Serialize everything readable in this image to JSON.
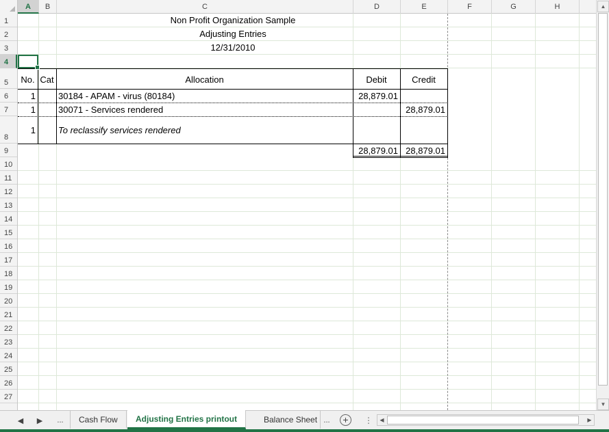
{
  "columns": [
    "A",
    "B",
    "C",
    "D",
    "E",
    "F",
    "G",
    "H"
  ],
  "selected_column": "A",
  "rows": [
    "1",
    "2",
    "3",
    "4",
    "5",
    "6",
    "7",
    "8",
    "9",
    "10",
    "11",
    "12",
    "13",
    "14",
    "15",
    "16",
    "17",
    "18",
    "19",
    "20",
    "21",
    "22",
    "23",
    "24",
    "25",
    "26",
    "27"
  ],
  "selected_row": "4",
  "report": {
    "org_name": "Non Profit Organization Sample",
    "report_title": "Adjusting Entries",
    "report_date": "12/31/2010"
  },
  "table": {
    "headers": {
      "no": "No.",
      "cat": "Cat",
      "allocation": "Allocation",
      "debit": "Debit",
      "credit": "Credit"
    },
    "entries": [
      {
        "no": "1",
        "allocation": "30184 - APAM - virus (80184)",
        "debit": "28,879.01",
        "credit": ""
      },
      {
        "no": "1",
        "allocation": "30071 - Services rendered",
        "debit": "",
        "credit": "28,879.01"
      },
      {
        "no": "1",
        "allocation": "To reclassify services rendered",
        "debit": "",
        "credit": ""
      }
    ],
    "totals": {
      "debit": "28,879.01",
      "credit": "28,879.01"
    }
  },
  "sheet_tabs": {
    "overflow_left": "...",
    "tabs": [
      "Cash Flow",
      "Adjusting Entries printout",
      "Balance Sheet"
    ],
    "active": "Adjusting Entries printout",
    "overflow_right": "..."
  },
  "colors": {
    "accent": "#217346",
    "gridline": "#dde8d8"
  }
}
